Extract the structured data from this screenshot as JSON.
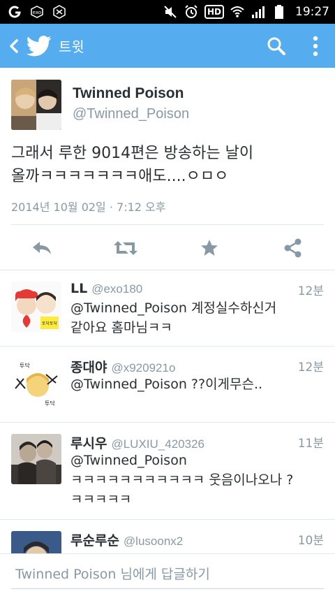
{
  "status_bar": {
    "time": "19:27",
    "hd_label": "HD",
    "notification_icons": [
      "g-app-icon",
      "exo-logo-icon",
      "exo-logo-icon"
    ],
    "system_icons": [
      "mute-icon",
      "alarm-icon",
      "hd-voice-icon",
      "wifi-icon",
      "signal-icon",
      "battery-icon"
    ]
  },
  "app_bar": {
    "title": "트윗",
    "background_color": "#55acee",
    "icons": [
      "back-icon",
      "twitter-bird-icon",
      "search-icon",
      "overflow-menu-icon"
    ]
  },
  "tweet": {
    "author_name": "Twinned Poison",
    "author_handle": "@Twinned_Poison",
    "text_line1": "그래서 루한 9014편은 방송하는 날이",
    "text_line2": "올까ㅋㅋㅋㅋㅋㅋㅋ애도....ㅇㅁㅇ",
    "timestamp": "2014년 10월 02일 · 7:12 오후",
    "actions": [
      "reply-icon",
      "retweet-icon",
      "favorite-icon",
      "share-icon"
    ]
  },
  "replies": [
    {
      "name": "LL",
      "handle": "@exo180",
      "time": "12분",
      "line1": "@Twinned_Poison 계정실수하신거",
      "line2": "같아요 홈마님ㅋㅋ",
      "line3": ""
    },
    {
      "name": "종대야",
      "handle": "@x920921o",
      "time": "12분",
      "line1": "@Twinned_Poison ??이게무슨..",
      "line2": "",
      "line3": ""
    },
    {
      "name": "루시우",
      "handle": "@LUXIU_420326",
      "time": "11분",
      "line1": "@Twinned_Poison",
      "line2": "ㅋㅋㅋㅋㅋㅋㅋㅋㅋㅋㅋ 웃음이나오나 ?",
      "line3": "ㅋㅋㅋㅋㅋ"
    },
    {
      "name": "루순루순",
      "handle": "@lusoonx2",
      "time": "10분",
      "line1": "",
      "line2": "",
      "line3": ""
    }
  ],
  "avatar_stickers": {
    "reply1_badge": "토닥토닥",
    "reply2_top": "투닥",
    "reply2_bottom": "투닥"
  },
  "reply_box": {
    "placeholder": "Twinned Poison 님에게 답글하기"
  }
}
